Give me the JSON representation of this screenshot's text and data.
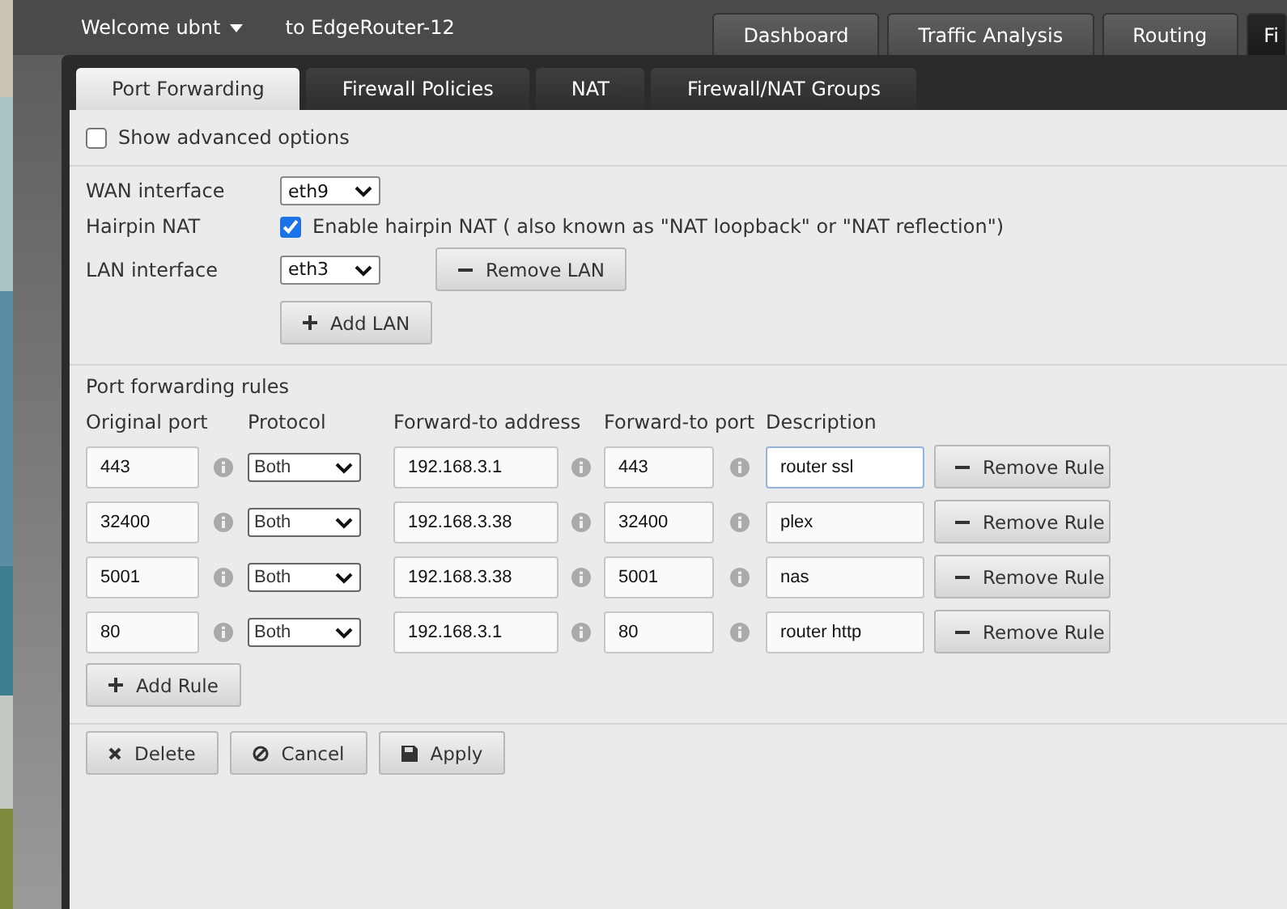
{
  "header": {
    "welcome": "Welcome ubnt",
    "device": "to EdgeRouter-12"
  },
  "nav_tabs": [
    {
      "label": "Dashboard",
      "selected": false
    },
    {
      "label": "Traffic Analysis",
      "selected": false
    },
    {
      "label": "Routing",
      "selected": false
    },
    {
      "label": "Fi",
      "selected": true
    }
  ],
  "tabs": [
    {
      "label": "Port Forwarding",
      "selected": true
    },
    {
      "label": "Firewall Policies",
      "selected": false
    },
    {
      "label": "NAT",
      "selected": false
    },
    {
      "label": "Firewall/NAT Groups",
      "selected": false
    }
  ],
  "show_advanced": {
    "label": "Show advanced options",
    "checked": false
  },
  "wan": {
    "label": "WAN interface",
    "value": "eth9"
  },
  "hairpin": {
    "label": "Hairpin NAT",
    "checkbox_label": "Enable hairpin NAT ( also known as \"NAT loopback\" or \"NAT reflection\")",
    "checked": true
  },
  "lan": {
    "label": "LAN interface",
    "value": "eth3",
    "remove_button": "Remove LAN"
  },
  "add_lan_button": "Add LAN",
  "rules_title": "Port forwarding rules",
  "columns": [
    "Original port",
    "Protocol",
    "Forward-to address",
    "Forward-to port",
    "Description"
  ],
  "rules": [
    {
      "original_port": "443",
      "protocol": "Both",
      "address": "192.168.3.1",
      "forward_port": "443",
      "description": "router ssl",
      "focused": true,
      "remove_button": "Remove Rule"
    },
    {
      "original_port": "32400",
      "protocol": "Both",
      "address": "192.168.3.38",
      "forward_port": "32400",
      "description": "plex",
      "focused": false,
      "remove_button": "Remove Rule"
    },
    {
      "original_port": "5001",
      "protocol": "Both",
      "address": "192.168.3.38",
      "forward_port": "5001",
      "description": "nas",
      "focused": false,
      "remove_button": "Remove Rule"
    },
    {
      "original_port": "80",
      "protocol": "Both",
      "address": "192.168.3.1",
      "forward_port": "80",
      "description": "router http",
      "focused": false,
      "remove_button": "Remove Rule"
    }
  ],
  "add_rule_button": "Add Rule",
  "actions": [
    {
      "kind": "delete",
      "label": "Delete"
    },
    {
      "kind": "cancel",
      "label": "Cancel"
    },
    {
      "kind": "apply",
      "label": "Apply"
    }
  ]
}
